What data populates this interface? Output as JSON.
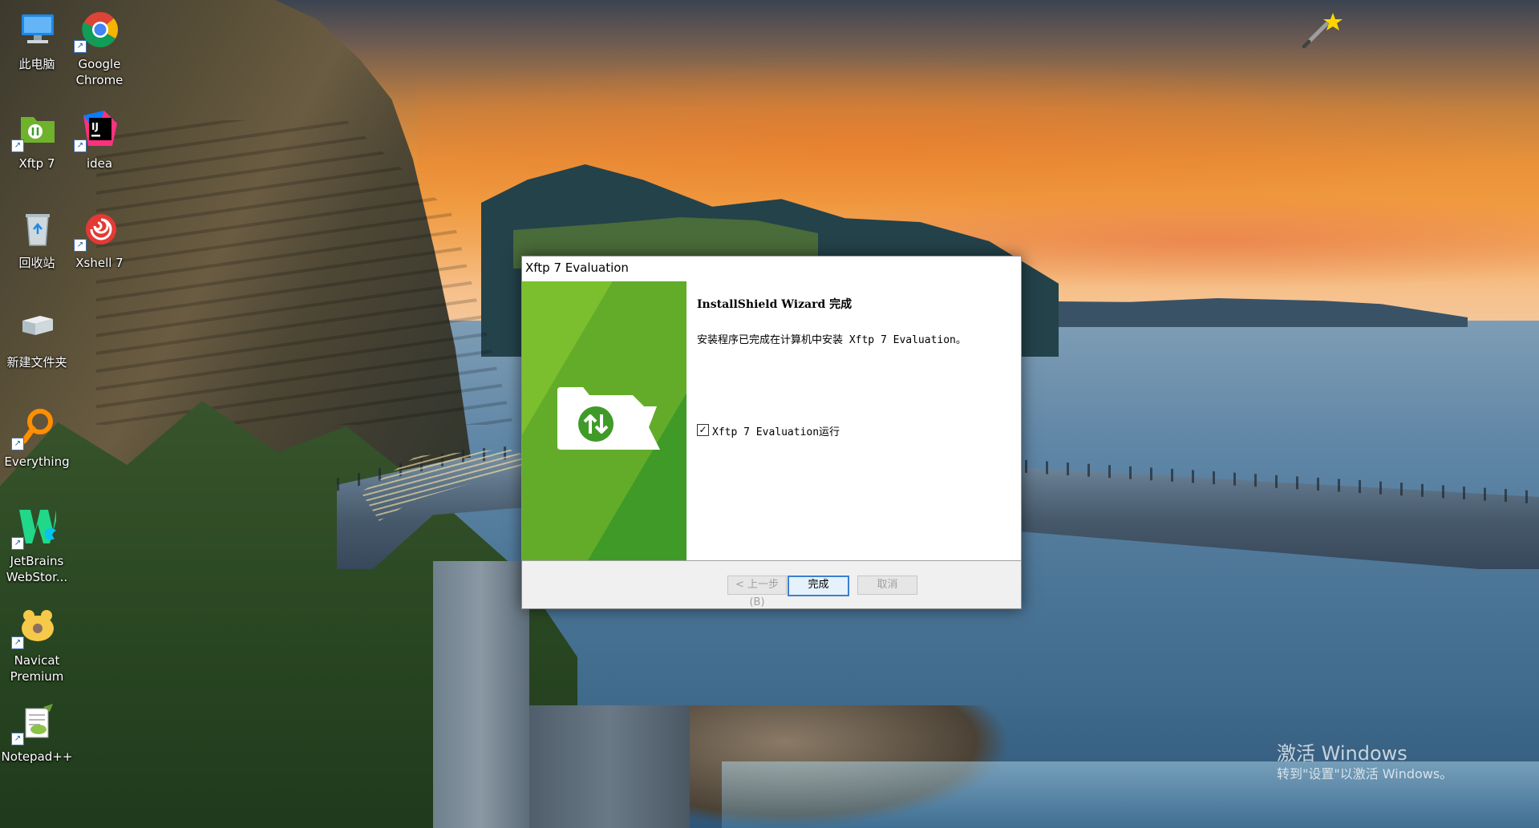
{
  "desktop": {
    "icons": [
      {
        "label": "此电脑",
        "icon": "computer-icon",
        "shortcut": false
      },
      {
        "label": "Google Chrome",
        "icon": "chrome-icon",
        "shortcut": true
      },
      {
        "label": "Xftp 7",
        "icon": "xftp-icon",
        "shortcut": true
      },
      {
        "label": "idea",
        "icon": "intellij-idea-icon",
        "shortcut": true
      },
      {
        "label": "回收站",
        "icon": "recycle-bin-icon",
        "shortcut": false
      },
      {
        "label": "Xshell 7",
        "icon": "xshell-icon",
        "shortcut": true
      },
      {
        "label": "新建文件夹",
        "icon": "folder-icon",
        "shortcut": false
      },
      {
        "label": "Everything",
        "icon": "everything-search-icon",
        "shortcut": true
      },
      {
        "label": "JetBrains WebStor...",
        "icon": "webstorm-icon",
        "shortcut": true
      },
      {
        "label": "Navicat Premium",
        "icon": "navicat-icon",
        "shortcut": true
      },
      {
        "label": "Notepad++",
        "icon": "notepadpp-icon",
        "shortcut": true
      }
    ],
    "shortcut_glyph": "↗"
  },
  "dialog": {
    "title": "Xftp 7 Evaluation",
    "heading": "InstallShield Wizard 完成",
    "message": "安装程序已完成在计算机中安装 Xftp 7 Evaluation。",
    "checkbox": {
      "label": "Xftp 7 Evaluation运行",
      "checked": true,
      "mark": "✓"
    },
    "buttons": {
      "back": "< 上一步(B)",
      "finish": "完成",
      "cancel": "取消"
    },
    "colors": {
      "banner_green": "#6fb22b",
      "accent": "#3c7fd0"
    }
  },
  "watermark": {
    "line1": "激活 Windows",
    "line2": "转到\"设置\"以激活 Windows。"
  }
}
